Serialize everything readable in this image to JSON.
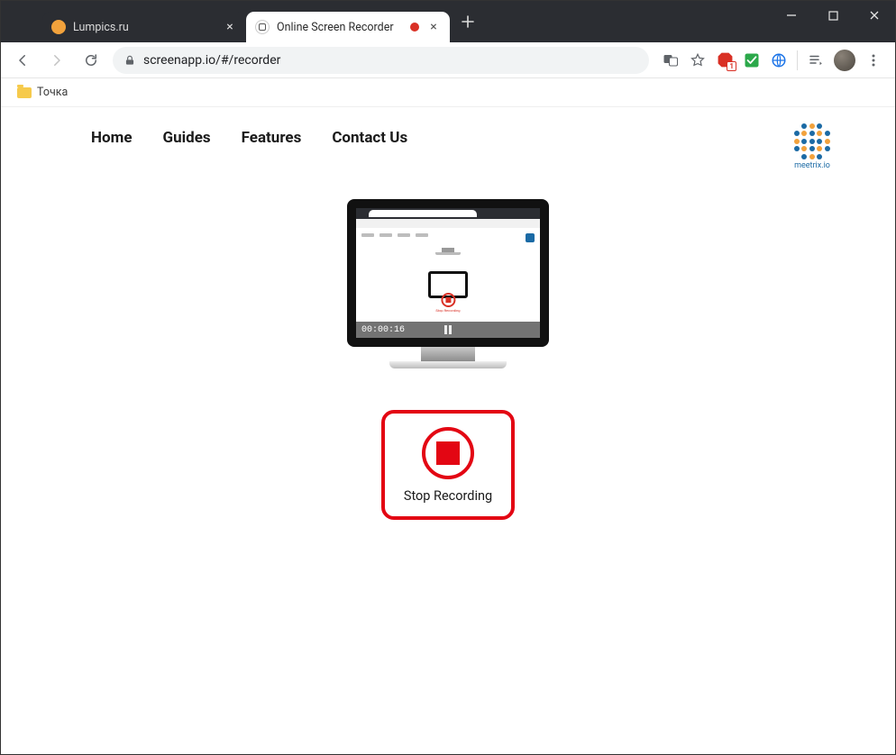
{
  "browser": {
    "tabs": [
      {
        "title": "Lumpics.ru",
        "active": false,
        "favicon_color": "#f2a23c"
      },
      {
        "title": "Online Screen Recorder",
        "active": true,
        "favicon": "screenapp"
      }
    ],
    "url_display": "screenapp.io/#/recorder",
    "bookmarks": [
      {
        "label": "Точка"
      }
    ]
  },
  "page": {
    "nav": [
      "Home",
      "Guides",
      "Features",
      "Contact Us"
    ],
    "brand_text": "meetrix.io",
    "recording_time": "00:00:16",
    "inner_stop_label": "Stop Recording",
    "stop_label": "Stop Recording"
  }
}
